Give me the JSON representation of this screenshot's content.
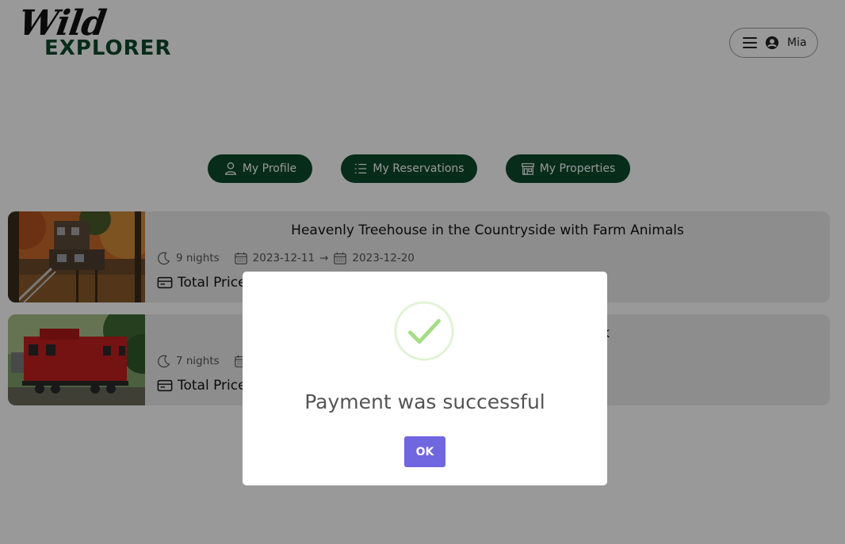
{
  "header": {
    "logo_wild": "Wild",
    "logo_explorer": "EXPLORER",
    "user_name": "Mia"
  },
  "nav": {
    "profile_label": "My Profile",
    "reservations_label": "My Reservations",
    "properties_label": "My Properties"
  },
  "reservations": [
    {
      "title": "Heavenly Treehouse in the Countryside with Farm Animals",
      "nights": "9 nights",
      "check_in": "2023-12-11",
      "arrow": "→",
      "check_out": "2023-12-20",
      "price_label": "Total Price:"
    },
    {
      "title_fragment": "te Park",
      "nights": "7 nights",
      "price_label": "Total Price:"
    }
  ],
  "modal": {
    "title": "Payment was successful",
    "ok_label": "OK"
  },
  "colors": {
    "brand_green": "#0d4a2b",
    "confirm_button": "#7066e0",
    "success_check": "#a5dc86"
  },
  "icons": [
    "menu-icon",
    "user-circle-icon",
    "user-icon",
    "list-icon",
    "store-icon",
    "moon-icon",
    "calendar-icon",
    "credit-card-icon",
    "success-check-icon"
  ]
}
